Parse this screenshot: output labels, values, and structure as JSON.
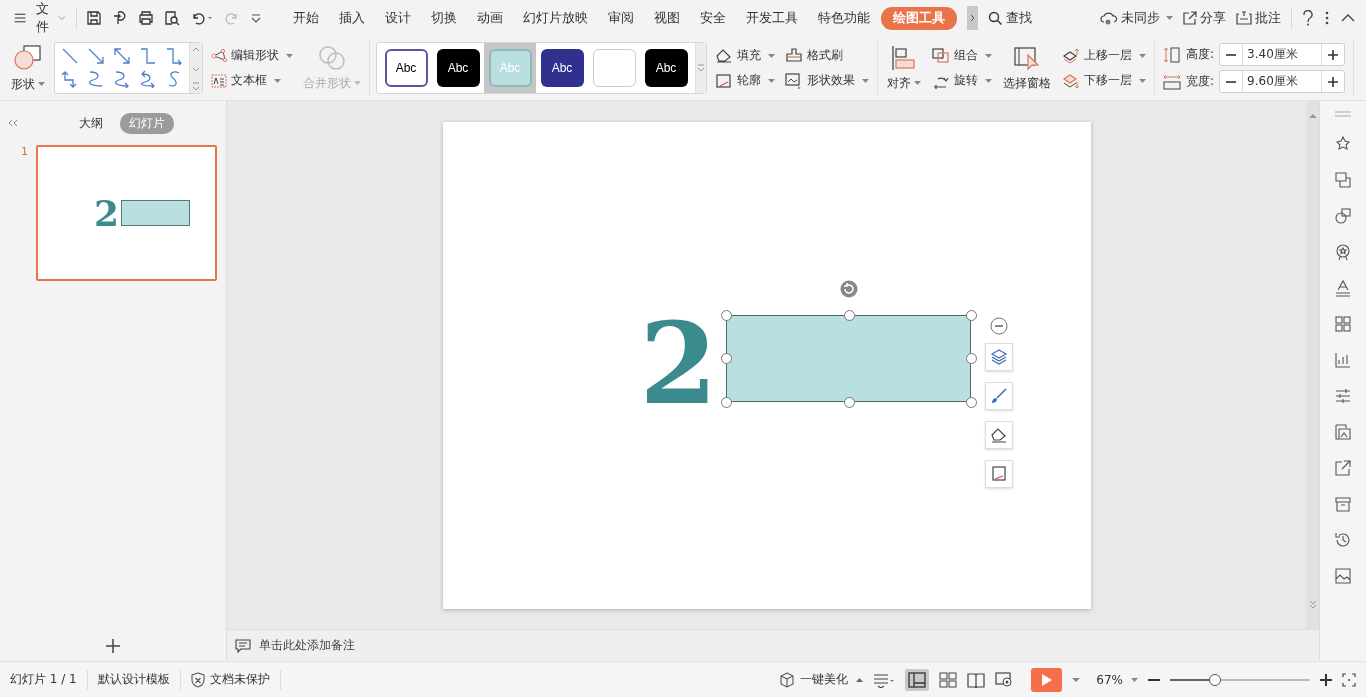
{
  "menu": {
    "file_label": "文件"
  },
  "tabs": [
    {
      "label": "开始",
      "selected": false
    },
    {
      "label": "插入",
      "selected": false
    },
    {
      "label": "设计",
      "selected": false
    },
    {
      "label": "切换",
      "selected": false
    },
    {
      "label": "动画",
      "selected": false
    },
    {
      "label": "幻灯片放映",
      "selected": false
    },
    {
      "label": "审阅",
      "selected": false
    },
    {
      "label": "视图",
      "selected": false
    },
    {
      "label": "安全",
      "selected": false
    },
    {
      "label": "开发工具",
      "selected": false
    },
    {
      "label": "特色功能",
      "selected": false
    },
    {
      "label": "绘图工具",
      "selected": true
    }
  ],
  "top_actions": {
    "search": "查找",
    "sync": "未同步",
    "share": "分享",
    "comment": "批注"
  },
  "ribbon": {
    "shapes": "形状",
    "edit_shape": "编辑形状",
    "text_box": "文本框",
    "merge_shapes": {
      "label": "合并形状",
      "disabled": true
    },
    "style_presets": [
      {
        "label": "Abc",
        "kind": "outline",
        "color": "#ffffff",
        "selected": false
      },
      {
        "label": "Abc",
        "kind": "dark",
        "color": "#000000",
        "selected": false
      },
      {
        "label": "Abc",
        "kind": "light",
        "color": "#b9dfe1",
        "selected": true
      },
      {
        "label": "Abc",
        "kind": "dark",
        "color": "#30308f",
        "selected": false
      },
      {
        "kind": "blank",
        "color": "#ffffff",
        "selected": false
      },
      {
        "label": "Abc",
        "kind": "dark",
        "color": "#000000",
        "selected": false
      }
    ],
    "fill": "填充",
    "format_painter": "格式刷",
    "outline": "轮廓",
    "shape_effects": "形状效果",
    "align": "对齐",
    "group": "组合",
    "rotate": "旋转",
    "selection_pane": "选择窗格",
    "bring_forward": "上移一层",
    "send_backward": "下移一层",
    "height": {
      "label": "高度:",
      "value": "3.40厘米"
    },
    "width": {
      "label": "宽度:",
      "value": "9.60厘米"
    }
  },
  "left_panel": {
    "tabs": [
      {
        "label": "大纲",
        "selected": false
      },
      {
        "label": "幻灯片",
        "selected": true
      }
    ],
    "slides": [
      {
        "number": "1",
        "selected": true,
        "text": "2"
      }
    ]
  },
  "slide": {
    "text": "2"
  },
  "notes_placeholder": "单击此处添加备注",
  "status_bar": {
    "slide_count": "幻灯片 1 / 1",
    "template": "默认设计模板",
    "protection": "文档未保护",
    "beautify": "一键美化",
    "zoom": "67%",
    "zoom_slider": {
      "level": 0.32
    }
  }
}
